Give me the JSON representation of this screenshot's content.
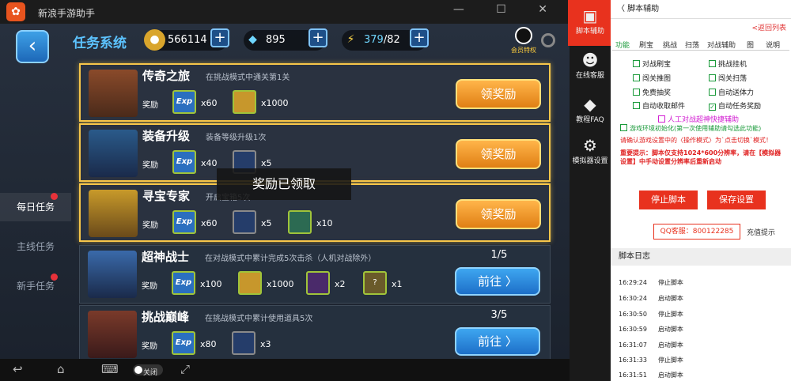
{
  "window": {
    "title": "新浪手游助手",
    "controls": "— ☐ ✕"
  },
  "game": {
    "title": "任务系统",
    "resources": {
      "coins": "566114",
      "diamonds": "895",
      "energy_current": "379",
      "energy_max": "/82"
    },
    "vip_label": "会员特权",
    "side_tabs": [
      {
        "label": "每日任务",
        "active": true,
        "dot": true
      },
      {
        "label": "主线任务",
        "active": false,
        "dot": false
      },
      {
        "label": "新手任务",
        "active": false,
        "dot": true
      }
    ],
    "reward_label": "奖励",
    "tasks": [
      {
        "name": "传奇之旅",
        "desc": "在挑战模式中通关第1关",
        "button": "领奖励",
        "rewards": [
          {
            "kind": "exp",
            "text": "Exp",
            "qty": "x60"
          },
          {
            "kind": "coin",
            "text": "",
            "qty": "x1000"
          }
        ]
      },
      {
        "name": "装备升级",
        "desc": "装备等级升级1次",
        "button": "领奖励",
        "rewards": [
          {
            "kind": "exp",
            "text": "Exp",
            "qty": "x40"
          },
          {
            "kind": "card",
            "text": "",
            "qty": "x5"
          }
        ]
      },
      {
        "name": "寻宝专家",
        "desc": "开启宝箱5次",
        "button": "领奖励",
        "rewards": [
          {
            "kind": "exp",
            "text": "Exp",
            "qty": "x60"
          },
          {
            "kind": "card",
            "text": "",
            "qty": "x5"
          },
          {
            "kind": "book",
            "text": "",
            "qty": "x10"
          }
        ]
      },
      {
        "name": "超神战士",
        "desc": "在对战模式中累计完成5次击杀（人机对战除外）",
        "progress": "1/5",
        "button": "前往 〉",
        "rewards": [
          {
            "kind": "exp",
            "text": "Exp",
            "qty": "x100"
          },
          {
            "kind": "coin",
            "text": "",
            "qty": "x1000"
          },
          {
            "kind": "wand",
            "text": "",
            "qty": "x2"
          },
          {
            "kind": "qm",
            "text": "?",
            "qty": "x1"
          }
        ]
      },
      {
        "name": "挑战巅峰",
        "desc": "在挑战模式中累计使用道具5次",
        "progress": "3/5",
        "button": "前往 〉",
        "rewards": [
          {
            "kind": "exp",
            "text": "Exp",
            "qty": "x80"
          },
          {
            "kind": "card",
            "text": "",
            "qty": "x3"
          }
        ]
      }
    ],
    "toast": "奖励已领取"
  },
  "navbar": {
    "toggle": "关闭"
  },
  "toolbar": [
    {
      "label": "脚本辅助",
      "glyph": "▣",
      "active": true
    },
    {
      "label": "在线客服",
      "glyph": "☻",
      "active": false
    },
    {
      "label": "教程FAQ",
      "glyph": "◆",
      "active": false
    },
    {
      "label": "模拟器设置",
      "glyph": "⚙",
      "active": false
    }
  ],
  "panel": {
    "title": "〈 脚本辅助",
    "return": "<返回列表",
    "tabs": [
      "功能",
      "刷宝",
      "挑战",
      "扫荡",
      "对战辅助",
      "图",
      "说明"
    ],
    "options": [
      {
        "label": "对战刷宝",
        "checked": false
      },
      {
        "label": "挑战挂机",
        "checked": false
      },
      {
        "label": "闯关推图",
        "checked": false
      },
      {
        "label": "闯关扫荡",
        "checked": false
      },
      {
        "label": "免费抽奖",
        "checked": false
      },
      {
        "label": "自动送体力",
        "checked": false
      },
      {
        "label": "自动收取邮件",
        "checked": false
      },
      {
        "label": "自动任务奖励",
        "checked": true
      }
    ],
    "manual_assist": "人工对战超神快捷辅助",
    "env_init": "游戏环境初始化(第一次使用辅助请勾选此功能)",
    "confirm": "请确认游戏设置中的〈操作模式〉为`点击切换`模式！",
    "important": "重要提示：脚本仅支持1024*600分辨率，请在【模拟器设置】中手动设置分辨率后重新启动",
    "stop": "停止脚本",
    "save": "保存设置",
    "qq": "QQ客服：800122285",
    "charge": "充值提示",
    "log_title": "脚本日志",
    "log": [
      {
        "time": "16:29:24",
        "msg": "停止脚本"
      },
      {
        "time": "16:30:24",
        "msg": "启动脚本"
      },
      {
        "time": "16:30:50",
        "msg": "停止脚本"
      },
      {
        "time": "16:30:59",
        "msg": "启动脚本"
      },
      {
        "time": "16:31:07",
        "msg": "启动脚本"
      },
      {
        "time": "16:31:33",
        "msg": "停止脚本"
      },
      {
        "time": "16:31:51",
        "msg": "启动脚本"
      }
    ]
  }
}
